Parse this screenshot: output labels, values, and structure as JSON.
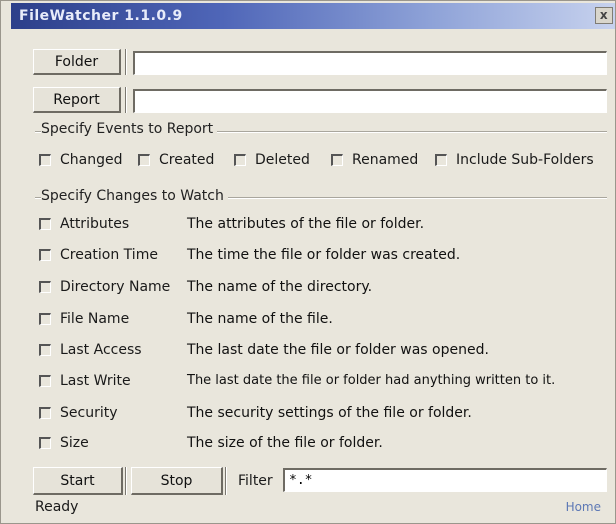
{
  "window": {
    "title": "FileWatcher 1.1.0.9",
    "close_glyph": "x"
  },
  "paths": {
    "folder_button": "Folder",
    "folder_value": "",
    "report_button": "Report",
    "report_value": ""
  },
  "events": {
    "group_label": "Specify Events to Report",
    "items": [
      {
        "label": "Changed",
        "checked": false
      },
      {
        "label": "Created",
        "checked": false
      },
      {
        "label": "Deleted",
        "checked": false
      },
      {
        "label": "Renamed",
        "checked": false
      },
      {
        "label": "Include Sub-Folders",
        "checked": false
      }
    ]
  },
  "changes": {
    "group_label": "Specify Changes to Watch",
    "items": [
      {
        "label": "Attributes",
        "description": "The attributes of the file or folder.",
        "checked": false
      },
      {
        "label": "Creation Time",
        "description": "The time the file or folder was created.",
        "checked": false
      },
      {
        "label": "Directory Name",
        "description": "The name of the directory.",
        "checked": false
      },
      {
        "label": "File Name",
        "description": "The name of the file.",
        "checked": false
      },
      {
        "label": "Last Access",
        "description": "The last date the file or folder was opened.",
        "checked": false
      },
      {
        "label": "Last Write",
        "description": "The last date the file or folder had anything written to it.",
        "checked": false
      },
      {
        "label": "Security",
        "description": "The security settings of the file or folder.",
        "checked": false
      },
      {
        "label": "Size",
        "description": "The size of the file or folder.",
        "checked": false
      }
    ]
  },
  "controls": {
    "start_label": "Start",
    "stop_label": "Stop",
    "filter_label": "Filter",
    "filter_value": "*.*"
  },
  "status": {
    "text": "Ready",
    "home_link": "Home"
  }
}
